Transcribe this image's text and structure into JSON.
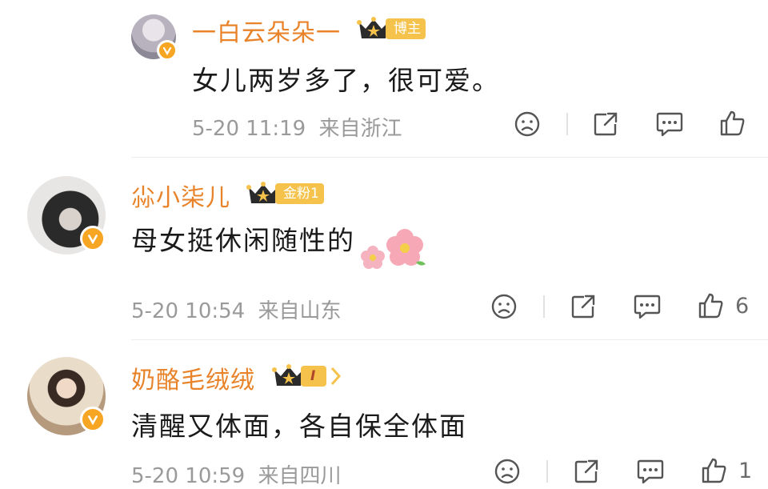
{
  "comments": [
    {
      "username": "一白云朵朵一",
      "badge": "博主",
      "text": "女儿两岁多了，很可爱。",
      "time": "5-20 11:19",
      "location": "来自浙江",
      "like_count": "",
      "avatar_icon": "avatar-grey-hair-girl"
    },
    {
      "username": "尛小柒儿",
      "badge": "金粉1",
      "text": "母女挺休闲随性的",
      "emoji": "flower-emoji",
      "time": "5-20 10:54",
      "location": "来自山东",
      "like_count": "6",
      "avatar_icon": "avatar-black-cap-girl"
    },
    {
      "username": "奶酪毛绒绒",
      "badge": "I",
      "text": "清醒又体面，各自保全体面",
      "time": "5-20 10:59",
      "location": "来自四川",
      "like_count": "1",
      "avatar_icon": "avatar-girl-photo"
    }
  ],
  "colors": {
    "username": "#e8832a",
    "badge": "#f5c24b",
    "verified": "#f6a623",
    "meta": "#9a9a9a"
  }
}
